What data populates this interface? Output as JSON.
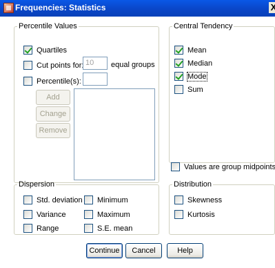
{
  "window": {
    "title": "Frequencies: Statistics",
    "close_glyph": "X",
    "icon": "spss-app-icon"
  },
  "percentile_values": {
    "legend": "Percentile Values",
    "quartiles": {
      "label": "Quartiles",
      "checked": true
    },
    "cut_points": {
      "label": "Cut points for:",
      "checked": false,
      "value": "10",
      "suffix": "equal groups"
    },
    "percentiles": {
      "label": "Percentile(s):",
      "checked": false,
      "value": ""
    },
    "buttons": {
      "add": "Add",
      "change": "Change",
      "remove": "Remove"
    },
    "list_items": []
  },
  "central_tendency": {
    "legend": "Central Tendency",
    "mean": {
      "label": "Mean",
      "checked": true
    },
    "median": {
      "label": "Median",
      "checked": true
    },
    "mode": {
      "label": "Mode",
      "checked": true
    },
    "sum": {
      "label": "Sum",
      "checked": false
    }
  },
  "group_midpoints": {
    "label": "Values are group midpoints",
    "checked": false
  },
  "dispersion": {
    "legend": "Dispersion",
    "std_deviation": {
      "label": "Std. deviation",
      "checked": false
    },
    "variance": {
      "label": "Variance",
      "checked": false
    },
    "range": {
      "label": "Range",
      "checked": false
    },
    "minimum": {
      "label": "Minimum",
      "checked": false
    },
    "maximum": {
      "label": "Maximum",
      "checked": false
    },
    "se_mean": {
      "label": "S.E. mean",
      "checked": false
    }
  },
  "distribution": {
    "legend": "Distribution",
    "skewness": {
      "label": "Skewness",
      "checked": false
    },
    "kurtosis": {
      "label": "Kurtosis",
      "checked": false
    }
  },
  "buttons": {
    "continue": "Continue",
    "cancel": "Cancel",
    "help": "Help"
  },
  "colors": {
    "titlebar": "#0a4ed8",
    "border": "#d0d0bf",
    "check": "#21a121"
  }
}
